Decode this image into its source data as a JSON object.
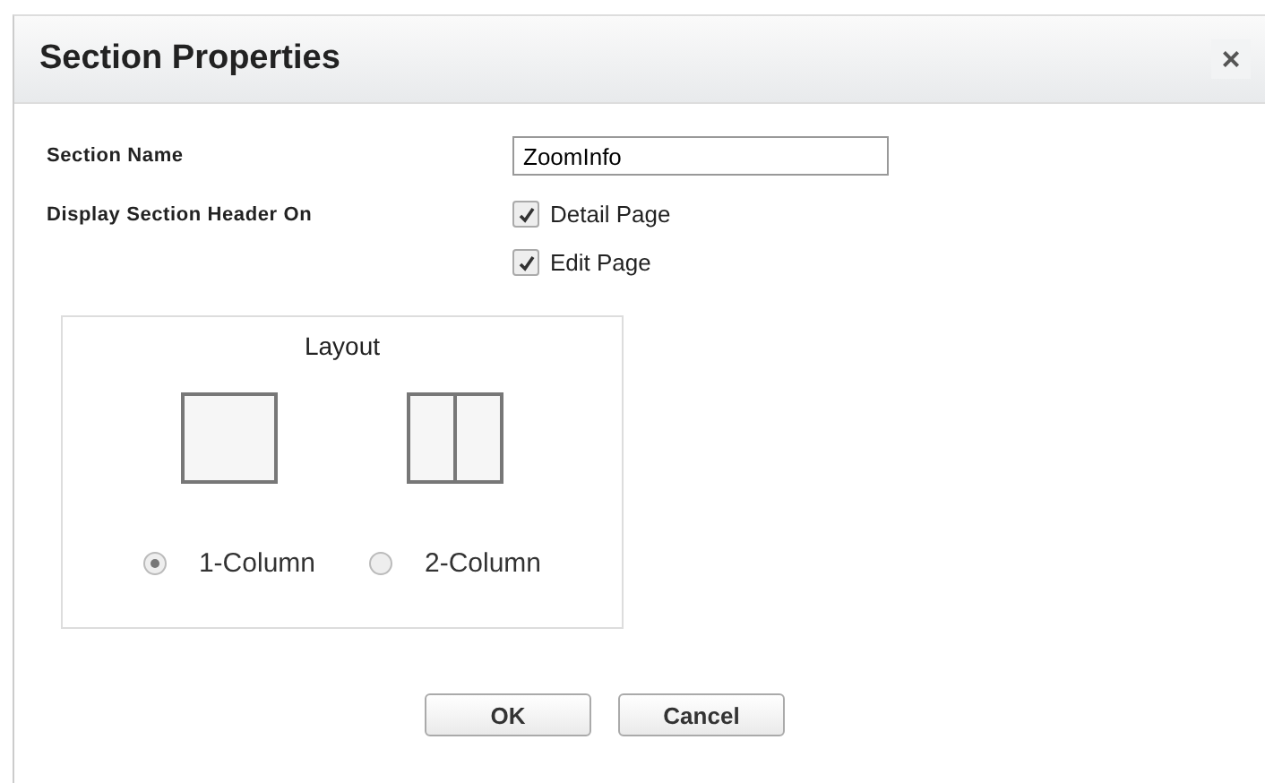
{
  "dialog": {
    "title": "Section Properties",
    "close": "×"
  },
  "section_name": {
    "label": "Section Name",
    "value": "ZoomInfo"
  },
  "display_header": {
    "label": "Display Section Header On",
    "options": [
      {
        "label": "Detail Page",
        "checked": true
      },
      {
        "label": "Edit Page",
        "checked": true
      }
    ]
  },
  "layout": {
    "title": "Layout",
    "options": [
      {
        "label": "1-Column",
        "kind": "single",
        "selected": true
      },
      {
        "label": "2-Column",
        "kind": "split",
        "selected": false
      }
    ]
  },
  "buttons": [
    "OK",
    "Cancel"
  ]
}
